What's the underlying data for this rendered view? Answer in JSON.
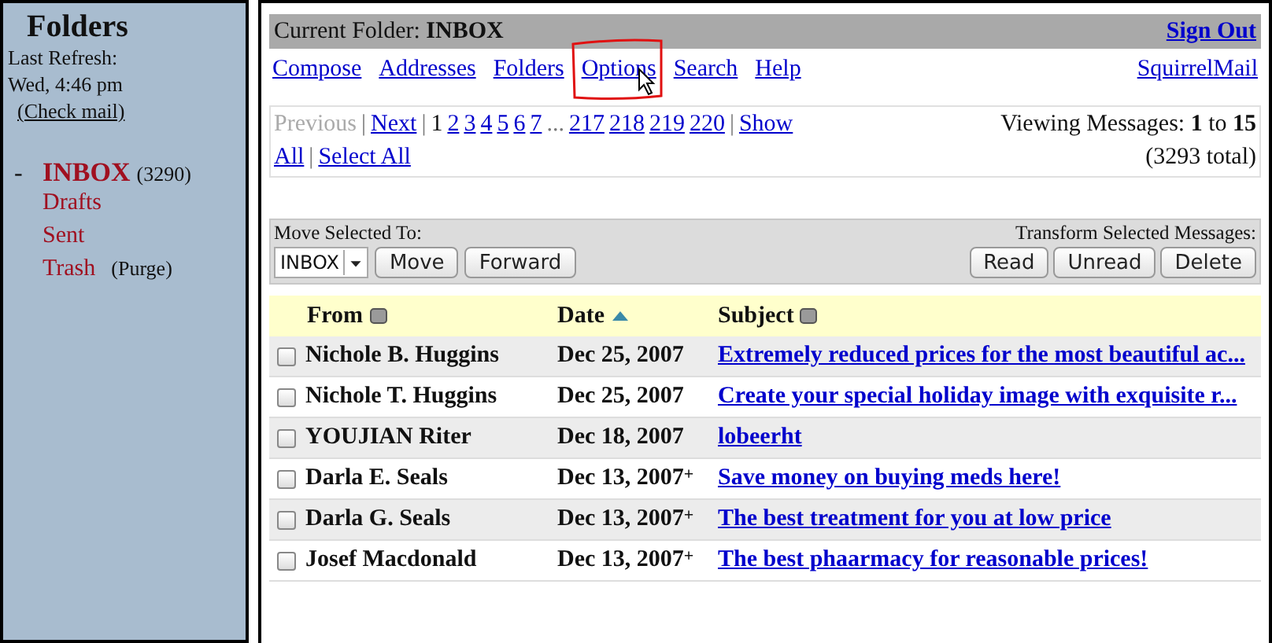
{
  "sidebar": {
    "title": "Folders",
    "refresh_label": "Last Refresh:",
    "refresh_time": "Wed, 4:46 pm",
    "check_mail": "(Check mail)",
    "collapse": "-",
    "folders": [
      {
        "name": "INBOX",
        "count": "(3290)",
        "selected": true
      },
      {
        "name": "Drafts",
        "selected": false
      },
      {
        "name": "Sent",
        "selected": false
      },
      {
        "name": "Trash",
        "action": "(Purge)",
        "selected": false
      }
    ]
  },
  "header": {
    "label": "Current Folder:",
    "folder": "INBOX",
    "sign_out": "Sign Out"
  },
  "nav": {
    "links": [
      {
        "label": "Compose",
        "highlighted": false
      },
      {
        "label": "Addresses",
        "highlighted": false
      },
      {
        "label": "Folders",
        "highlighted": false
      },
      {
        "label": "Options",
        "highlighted": true
      },
      {
        "label": "Search",
        "highlighted": false
      },
      {
        "label": "Help",
        "highlighted": false
      }
    ],
    "brand": "SquirrelMail"
  },
  "pagination": {
    "previous": {
      "label": "Previous",
      "disabled": true
    },
    "next": {
      "label": "Next",
      "disabled": false
    },
    "pages": [
      {
        "label": "1",
        "selected": true
      },
      {
        "label": "2",
        "selected": false
      },
      {
        "label": "3",
        "selected": false
      },
      {
        "label": "4",
        "selected": false
      },
      {
        "label": "5",
        "selected": false
      },
      {
        "label": "6",
        "selected": false
      },
      {
        "label": "7",
        "selected": false
      },
      {
        "label": "...",
        "kind": "gap"
      },
      {
        "label": "217",
        "selected": false
      },
      {
        "label": "218",
        "selected": false
      },
      {
        "label": "219",
        "selected": false
      },
      {
        "label": "220",
        "selected": false
      }
    ],
    "separators": [
      "|",
      "|",
      "|",
      "|"
    ],
    "show_all": "Show All",
    "select_all": "Select All",
    "viewing_label": "Viewing Messages:",
    "from": "1",
    "to_word": "to",
    "to": "15",
    "total": "(3293 total)"
  },
  "toolbar": {
    "move_label": "Move Selected To:",
    "folder_select": "INBOX",
    "move_buttons": [
      "Move",
      "Forward"
    ],
    "transform_label": "Transform Selected Messages:",
    "transform_buttons": [
      "Read",
      "Unread",
      "Delete"
    ]
  },
  "table": {
    "columns": [
      {
        "label": "From",
        "sorted": false
      },
      {
        "label": "Date",
        "sorted": true
      },
      {
        "label": "Subject",
        "sorted": false
      }
    ],
    "rows": [
      {
        "from": "Nichole B. Huggins",
        "date": "Dec 25, 2007",
        "subject": "Extremely reduced prices for the most beautiful ac...",
        "checked": false
      },
      {
        "from": "Nichole T. Huggins",
        "date": "Dec 25, 2007",
        "subject": "Create your special holiday image with exquisite r...",
        "checked": false
      },
      {
        "from": "YOUJIAN Riter",
        "date": "Dec 18, 2007",
        "subject": "lobeerht",
        "checked": false
      },
      {
        "from": "Darla E. Seals",
        "date": "Dec 13, 2007",
        "marker": "+",
        "subject": "Save money on buying meds here!",
        "checked": false
      },
      {
        "from": "Darla G. Seals",
        "date": "Dec 13, 2007",
        "marker": "+",
        "subject": "The best treatment for you at low price",
        "checked": false
      },
      {
        "from": "Josef Macdonald",
        "date": "Dec 13, 2007",
        "marker": "+",
        "subject": "The best phaarmacy for reasonable prices!",
        "checked": false
      }
    ]
  }
}
